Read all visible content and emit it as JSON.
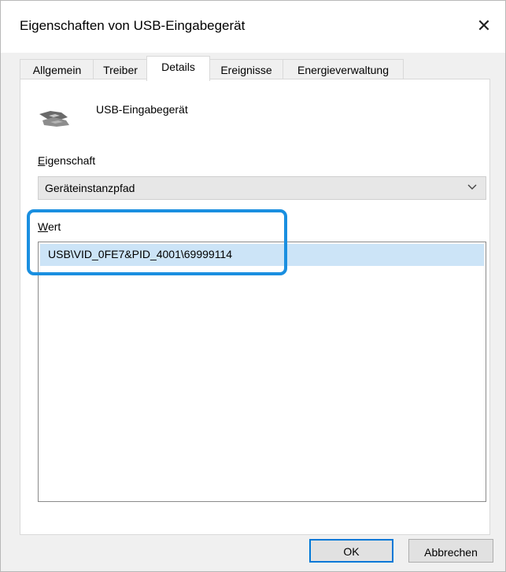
{
  "window": {
    "title": "Eigenschaften von USB-Eingabegerät",
    "close_icon": "close-icon"
  },
  "tabs": [
    {
      "label": "Allgemein",
      "active": false
    },
    {
      "label": "Treiber",
      "active": false
    },
    {
      "label": "Details",
      "active": true
    },
    {
      "label": "Ereignisse",
      "active": false
    },
    {
      "label": "Energieverwaltung",
      "active": false
    }
  ],
  "device": {
    "name": "USB-Eingabegerät",
    "icon": "usb-device-icon"
  },
  "property": {
    "label_prefix": "E",
    "label_rest": "igenschaft",
    "selected_value": "Geräteinstanzpfad"
  },
  "value": {
    "label_prefix": "W",
    "label_rest": "ert",
    "items": [
      "USB\\VID_0FE7&PID_4001\\69999114"
    ]
  },
  "buttons": {
    "ok": "OK",
    "cancel": "Abbrechen"
  },
  "colors": {
    "accent": "#0078d7",
    "highlight": "#1a8fe0",
    "selection": "#cce4f7"
  }
}
